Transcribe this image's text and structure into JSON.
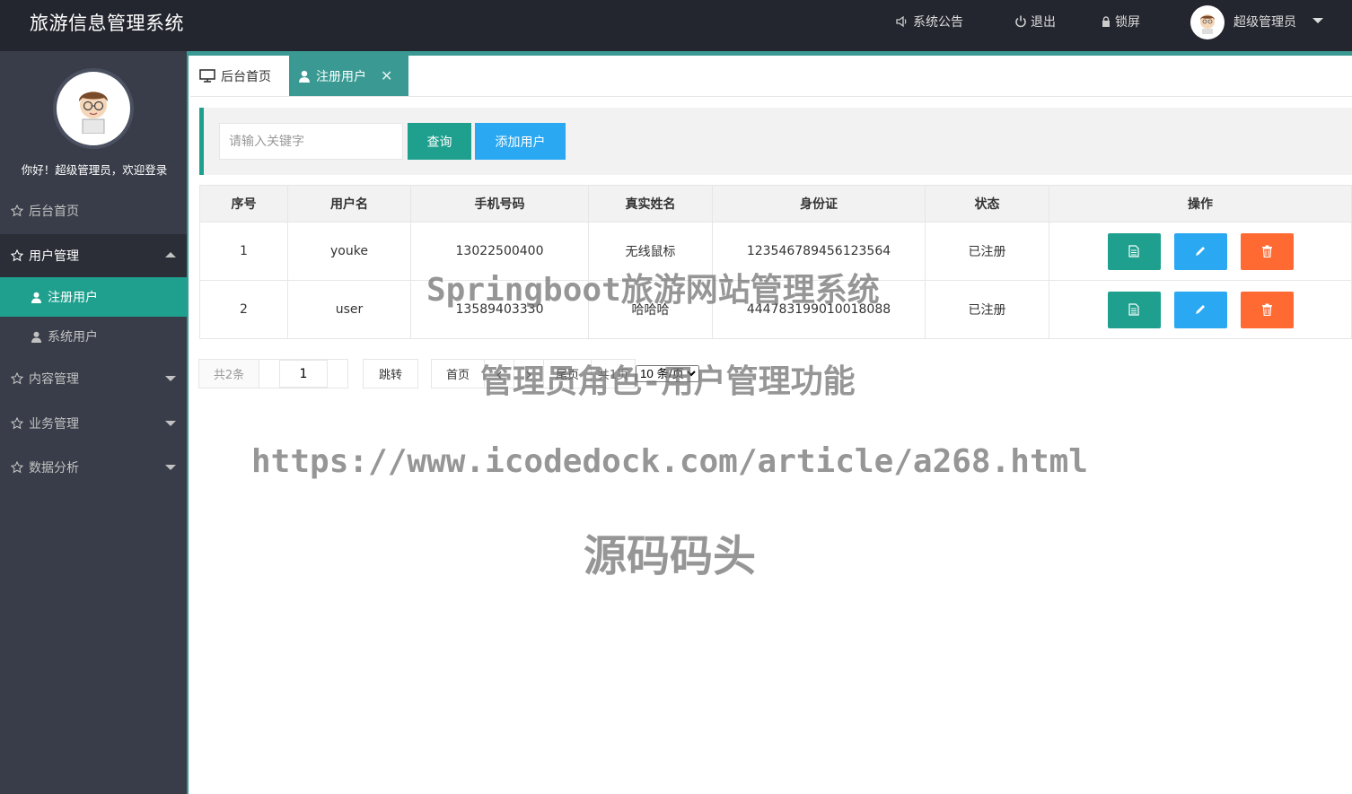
{
  "header": {
    "title": "旅游信息管理系统",
    "announce_label": "系统公告",
    "logout_label": "退出",
    "lock_label": "锁屏",
    "user_name": "超级管理员"
  },
  "sidebar": {
    "welcome": "你好！超级管理员，欢迎登录",
    "items": [
      {
        "label": "后台首页"
      },
      {
        "label": "用户管理"
      },
      {
        "label": "注册用户"
      },
      {
        "label": "系统用户"
      },
      {
        "label": "内容管理"
      },
      {
        "label": "业务管理"
      },
      {
        "label": "数据分析"
      }
    ]
  },
  "tabs": [
    {
      "label": "后台首页"
    },
    {
      "label": "注册用户"
    }
  ],
  "search": {
    "placeholder": "请输入关键字",
    "query_label": "查询",
    "add_label": "添加用户"
  },
  "table": {
    "columns": [
      "序号",
      "用户名",
      "手机号码",
      "真实姓名",
      "身份证",
      "状态",
      "操作"
    ],
    "rows": [
      {
        "no": "1",
        "username": "youke",
        "phone": "13022500400",
        "realname": "无线鼠标",
        "idcard": "123546789456123564",
        "status": "已注册"
      },
      {
        "no": "2",
        "username": "user",
        "phone": "13589403330",
        "realname": "哈哈哈",
        "idcard": "444783199010018088",
        "status": "已注册"
      }
    ]
  },
  "pager": {
    "count": "共2条",
    "page_value": "1",
    "jump_label": "跳转",
    "first_label": "首页",
    "last_label": "尾页",
    "total_pages": "共1页",
    "page_size": "10 条/页"
  },
  "watermark": {
    "line1": "Springboot旅游网站管理系统",
    "line2": "管理员角色-用户管理功能",
    "line3": "https://www.icodedock.com/article/a268.html",
    "line4": "源码码头"
  },
  "colors": {
    "header_bg": "#23262e",
    "sidebar_bg": "#393d49",
    "accent_green": "#1fa08f",
    "tab_active": "#3a9a93",
    "blue": "#2aa8f2",
    "orange": "#ff6a33"
  }
}
